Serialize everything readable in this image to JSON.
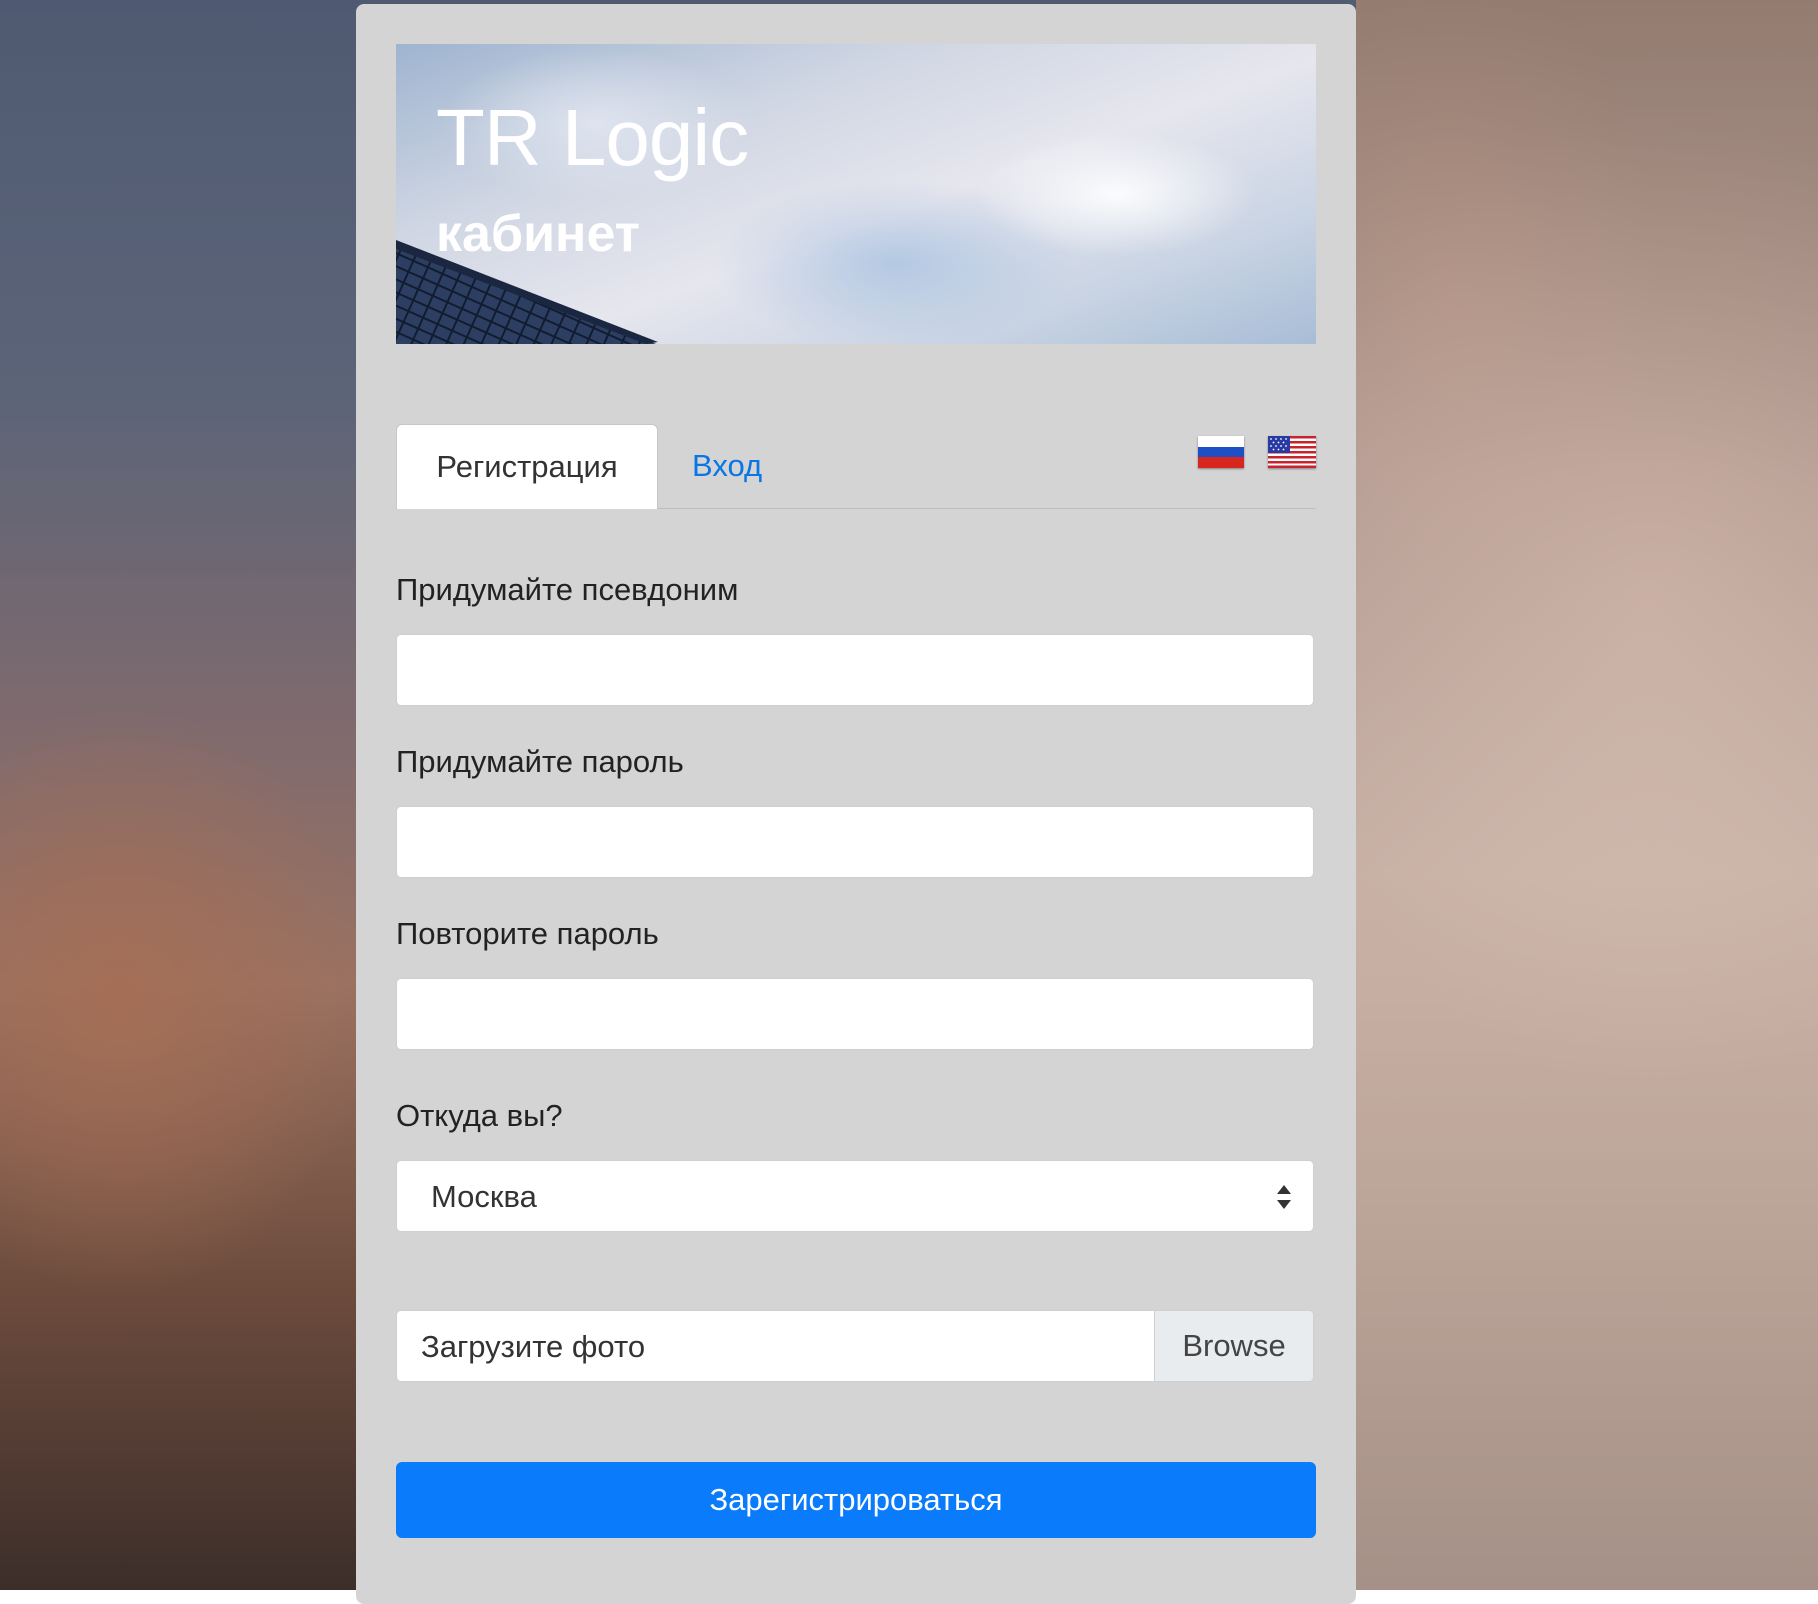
{
  "banner": {
    "title": "TR Logic",
    "subtitle": "кабинет"
  },
  "tabs": [
    {
      "label": "Регистрация",
      "active": true
    },
    {
      "label": "Вход",
      "active": false
    }
  ],
  "languages": [
    {
      "name": "ru-flag-icon"
    },
    {
      "name": "us-flag-icon"
    }
  ],
  "form": {
    "nickname_label": "Придумайте псевдоним",
    "nickname_value": "",
    "password_label": "Придумайте пароль",
    "password_value": "",
    "repeat_label": "Повторите пароль",
    "repeat_value": "",
    "city_label": "Откуда вы?",
    "city_value": "Москва",
    "photo_label": "Загрузите фото",
    "browse_label": "Browse",
    "submit_label": "Зарегистрироваться"
  },
  "colors": {
    "accent": "#0a7bfb",
    "link": "#0a76e6",
    "card": "#d4d4d4"
  }
}
